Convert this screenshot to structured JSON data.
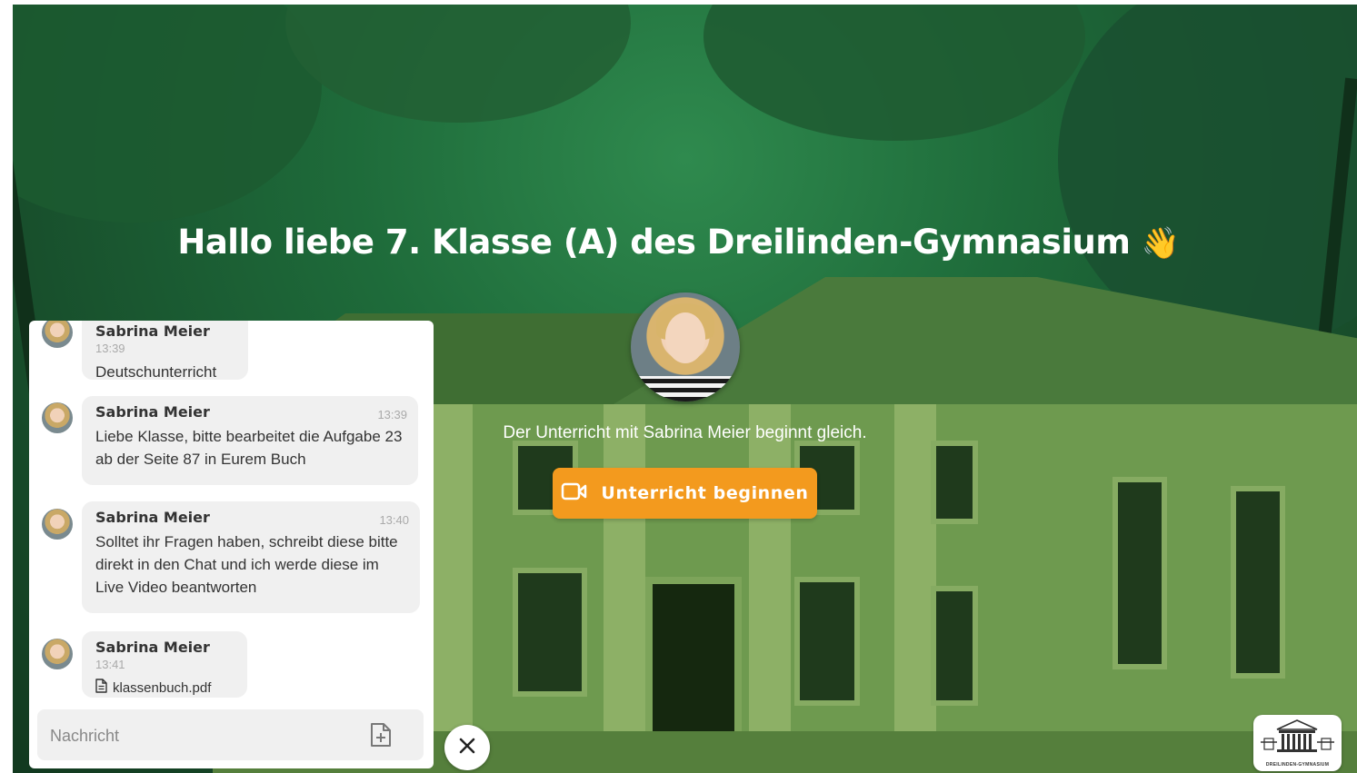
{
  "header": {
    "title": "Hallo liebe 7. Klasse (A) des Dreilinden-Gymnasium",
    "title_emoji": "👋"
  },
  "teacher": {
    "status_text": "Der Unterricht mit Sabrina Meier beginnt gleich.",
    "start_button_label": "Unterricht beginnen",
    "start_button_color": "#f39a1e"
  },
  "chat": {
    "messages": [
      {
        "author": "Sabrina Meier",
        "time": "13:39",
        "text": "Deutschunterricht"
      },
      {
        "author": "Sabrina Meier",
        "time": "13:39",
        "text": "Liebe Klasse, bitte bearbeitet die Aufgabe 23 ab der Seite 87 in Eurem Buch"
      },
      {
        "author": "Sabrina Meier",
        "time": "13:40",
        "text": "Solltet ihr Fragen haben, schreibt diese bitte direkt in den Chat und ich werde diese im Live Video beantworten"
      },
      {
        "author": "Sabrina Meier",
        "time": "13:41",
        "file": "klassenbuch.pdf"
      }
    ],
    "input_placeholder": "Nachricht",
    "input_value": ""
  },
  "school_logo": {
    "text": "DREILINDEN-GYMNASIUM"
  },
  "icons": {
    "close": "close-icon",
    "attach": "file-add-icon",
    "video": "video-camera-icon",
    "file": "document-icon"
  },
  "colors": {
    "accent": "#f39a1e",
    "background_tint": "#1e6b3a"
  }
}
